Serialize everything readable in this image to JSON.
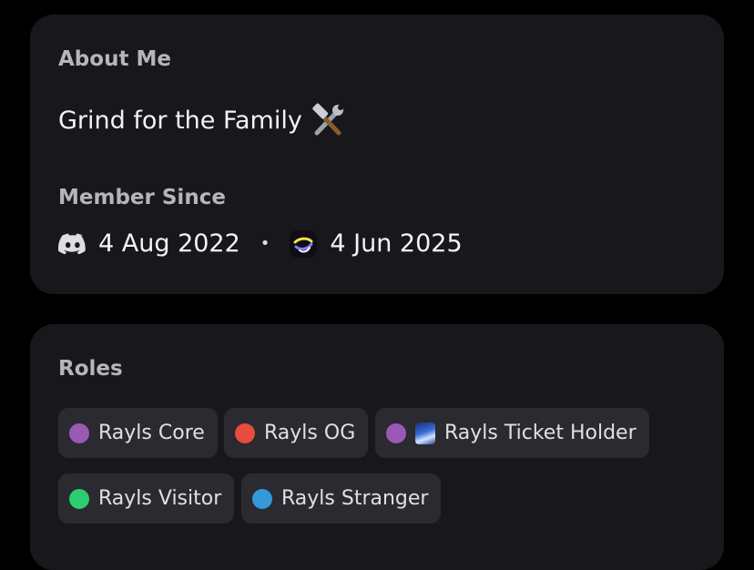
{
  "about": {
    "label": "About Me",
    "bio": "Grind for the Family",
    "bio_emoji": "hammer-and-wrench-icon"
  },
  "member_since": {
    "label": "Member Since",
    "discord_date": "4 Aug 2022",
    "separator": "•",
    "server_date": "4 Jun 2025"
  },
  "roles": {
    "label": "Roles",
    "items": [
      {
        "name": "Rayls Core",
        "color": "#9b59b6"
      },
      {
        "name": "Rayls OG",
        "color": "#e74c3c"
      },
      {
        "name": "Rayls Ticket Holder",
        "color": "#9b59b6",
        "icon": "ticket-role-icon"
      },
      {
        "name": "Rayls Visitor",
        "color": "#2ecc71"
      },
      {
        "name": "Rayls Stranger",
        "color": "#3498db"
      }
    ]
  },
  "colors": {
    "background": "#000000",
    "card": "#18181c",
    "pill": "#2a2a30",
    "text": "#f2f3f5",
    "label": "#b5b6bd"
  }
}
